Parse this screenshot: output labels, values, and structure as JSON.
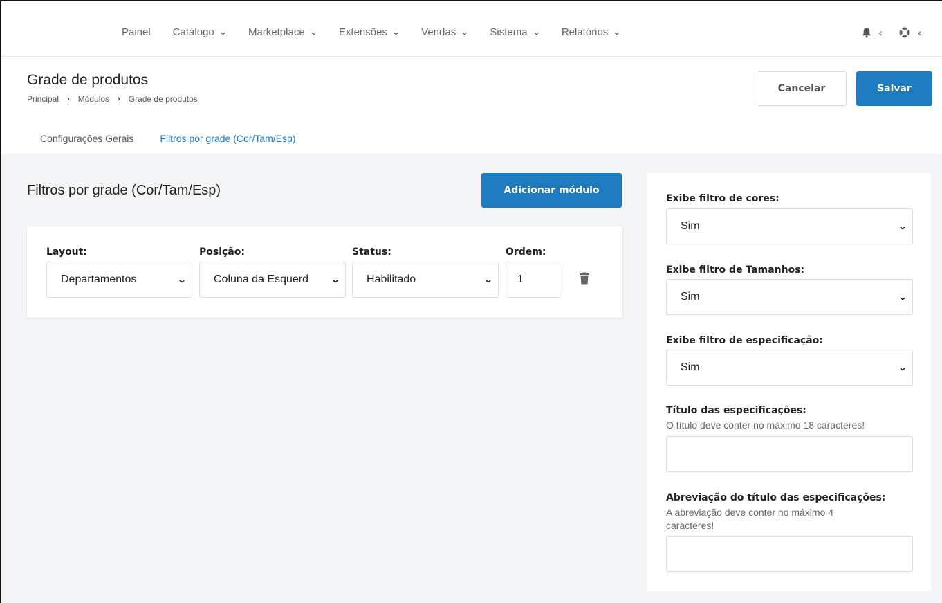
{
  "nav": {
    "items": [
      {
        "label": "Painel",
        "has_dropdown": false
      },
      {
        "label": "Catálogo",
        "has_dropdown": true
      },
      {
        "label": "Marketplace",
        "has_dropdown": true
      },
      {
        "label": "Extensões",
        "has_dropdown": true
      },
      {
        "label": "Vendas",
        "has_dropdown": true
      },
      {
        "label": "Sistema",
        "has_dropdown": true
      },
      {
        "label": "Relatórios",
        "has_dropdown": true
      }
    ],
    "icons": [
      "bell-icon",
      "lifebuoy-icon"
    ]
  },
  "header": {
    "title": "Grade de produtos",
    "breadcrumb": [
      "Principal",
      "Módulos",
      "Grade de produtos"
    ],
    "cancel_label": "Cancelar",
    "save_label": "Salvar"
  },
  "tabs": [
    {
      "label": "Configurações Gerais",
      "active": false
    },
    {
      "label": "Filtros por grade (Cor/Tam/Esp)",
      "active": true
    }
  ],
  "main": {
    "section_title": "Filtros por grade (Cor/Tam/Esp)",
    "add_label": "Adicionar módulo",
    "module": {
      "layout_label": "Layout:",
      "layout_value": "Departamentos",
      "position_label": "Posição:",
      "position_value": "Coluna da Esquerd",
      "status_label": "Status:",
      "status_value": "Habilitado",
      "order_label": "Ordem:",
      "order_value": "1"
    }
  },
  "side": {
    "colors_label": "Exibe filtro de cores:",
    "colors_value": "Sim",
    "sizes_label": "Exibe filtro de Tamanhos:",
    "sizes_value": "Sim",
    "spec_label": "Exibe filtro de especificação:",
    "spec_value": "Sim",
    "spec_title_label": "Título das especificações:",
    "spec_title_help": "O título deve conter no máximo 18 caracteres!",
    "spec_title_value": "",
    "spec_abbr_label": "Abreviação do título das especificações:",
    "spec_abbr_help": "A abreviação deve conter no máximo 4 caracteres!",
    "spec_abbr_value": ""
  },
  "colors": {
    "accent": "#1e7bbf",
    "background": "#f4f5f7"
  }
}
